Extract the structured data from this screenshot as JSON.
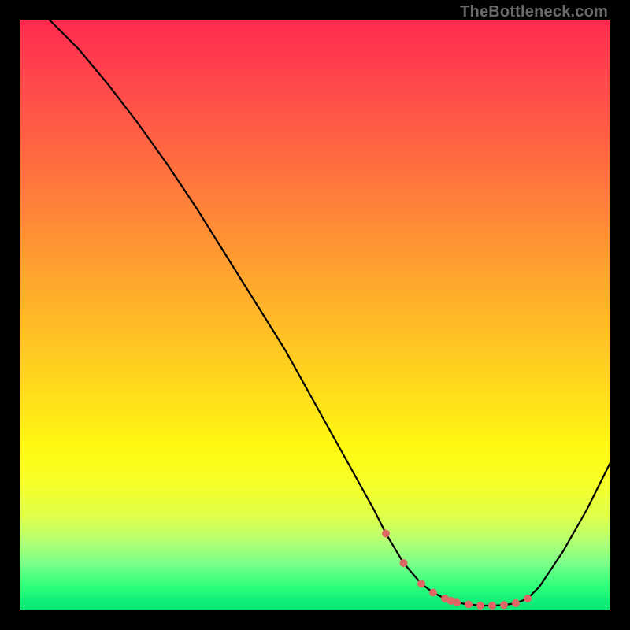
{
  "watermark": "TheBottleneck.com",
  "colors": {
    "background": "#000000",
    "curve": "#000000",
    "marker": "#e06666",
    "gradient_top": "#ff2a4f",
    "gradient_bottom": "#00e676"
  },
  "chart_data": {
    "type": "line",
    "title": "",
    "xlabel": "",
    "ylabel": "",
    "xlim": [
      0,
      100
    ],
    "ylim": [
      0,
      100
    ],
    "series": [
      {
        "name": "bottleneck-curve",
        "x": [
          5,
          10,
          15,
          20,
          25,
          30,
          35,
          40,
          45,
          50,
          55,
          60,
          62,
          65,
          68,
          70,
          72,
          74,
          76,
          78,
          80,
          82,
          84,
          86,
          88,
          92,
          96,
          100
        ],
        "values": [
          100,
          95,
          89,
          82.5,
          75.5,
          68,
          60,
          52,
          44,
          35,
          26,
          17,
          13,
          8,
          4.5,
          3,
          2,
          1.3,
          1,
          0.8,
          0.8,
          0.9,
          1.2,
          2,
          4,
          10,
          17,
          25
        ],
        "markers_x": [
          62,
          65,
          68,
          70,
          72,
          73,
          74,
          76,
          78,
          80,
          82,
          84,
          86
        ],
        "markers_values": [
          13,
          8,
          4.5,
          3,
          2,
          1.6,
          1.3,
          1,
          0.8,
          0.8,
          0.9,
          1.2,
          2
        ]
      }
    ]
  }
}
